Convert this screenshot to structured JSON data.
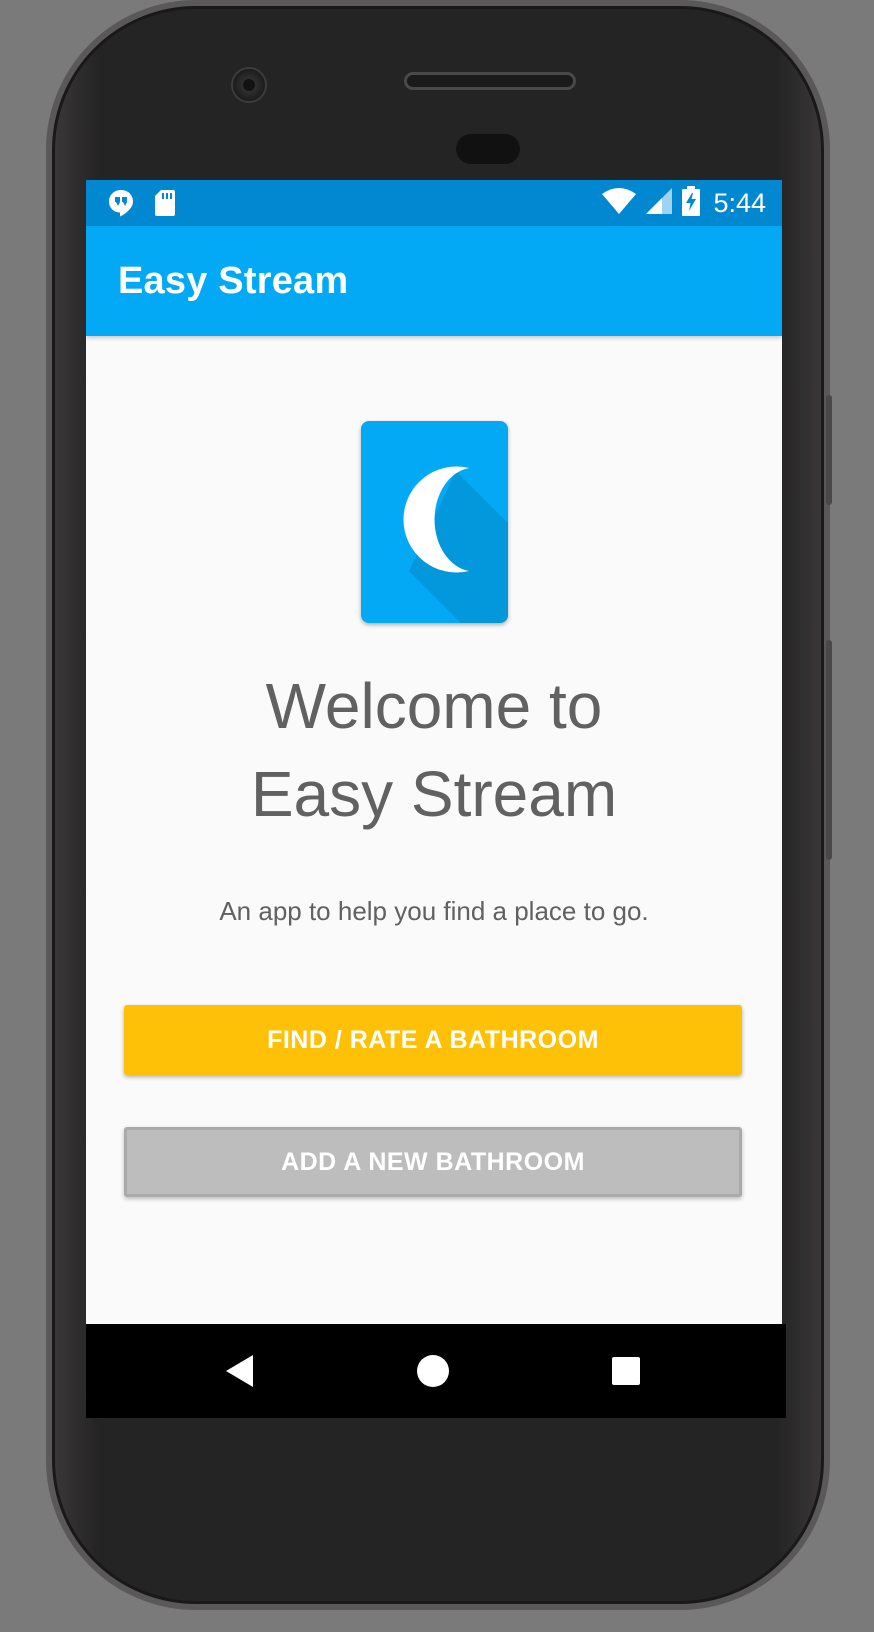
{
  "status_bar": {
    "time": "5:44",
    "icons": [
      "hangouts-icon",
      "sd-card-icon",
      "wifi-icon",
      "cell-signal-icon",
      "battery-charging-icon"
    ]
  },
  "app_bar": {
    "title": "Easy Stream"
  },
  "main": {
    "logo_icon": "moon-icon",
    "welcome_line1": "Welcome to",
    "welcome_line2": "Easy Stream",
    "subtitle": "An app to help you find a place to go.",
    "find_button_label": "FIND / RATE A BATHROOM",
    "add_button_label": "ADD A NEW BATHROOM"
  },
  "colors": {
    "status_bar": "#0288d1",
    "app_bar": "#03a9f4",
    "find_button": "#ffc107",
    "add_button": "#bdbdbd"
  },
  "nav_bar": {
    "icons": [
      "back-icon",
      "home-icon",
      "recents-icon"
    ]
  }
}
